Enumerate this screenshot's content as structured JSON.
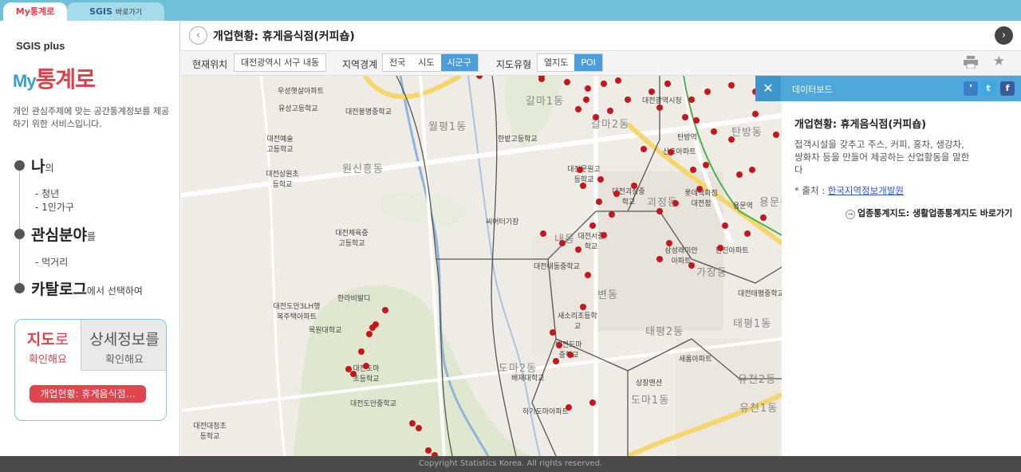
{
  "tabs": {
    "my": "My통계로",
    "sgis_brand": "SGIS",
    "sgis_small": "바로가기"
  },
  "sidebar": {
    "sgis_logo": "SGIS plus",
    "my_logo_my": "My",
    "my_logo_rest": "통계로",
    "description": "개인 관심주제에 맞는 공간통계정보를 제공하기 위한 서비스입니다.",
    "menu": [
      {
        "label": "나",
        "suffix": "의",
        "subs": [
          "- 청년",
          "- 1인가구"
        ]
      },
      {
        "label": "관심분야",
        "suffix": "를",
        "subs": [
          "- 먹거리"
        ]
      },
      {
        "label": "카탈로그",
        "suffix": "에서 선택하여",
        "subs": []
      }
    ],
    "result_tabs": {
      "map_big_a": "지도",
      "map_big_b": "로",
      "map_small": "확인해요",
      "detail_big": "상세정보를",
      "detail_small": "확인해요"
    },
    "selected_pill": "개업현황: 휴게음식점…"
  },
  "titlebar": {
    "back_icon": "chevron-left-icon",
    "title": "개업현황: 휴게음식점(커피숍)",
    "next_icon": "chevron-right-icon"
  },
  "toolbar": {
    "location_label": "현재위치",
    "location_value": "대전광역시 서구 내동",
    "region_label": "지역경계",
    "region_options": [
      "전국",
      "시도",
      "시군구"
    ],
    "region_selected": "시군구",
    "maptype_label": "지도유형",
    "maptype_options": [
      "열지도",
      "POI"
    ],
    "maptype_selected": "POI"
  },
  "map": {
    "labels": [
      "우성햇살아파트",
      "유성고등학교",
      "대전봉명중학교",
      "월평1동",
      "갈마1동",
      "한밭고등학교",
      "대전예술고등학교",
      "원신흥동",
      "대전상원초등학교",
      "대전문원고등학교",
      "갈마2동",
      "대전광역시청",
      "탄방역",
      "산호아파트",
      "탄방동",
      "대전괴정중학교",
      "괴정동",
      "롯데백화점대전점",
      "용문역",
      "용문동",
      "씨어터기장",
      "대전체육중고등학교",
      "내동",
      "대전서중학교",
      "대전내동중학교",
      "삼성래미안아파트",
      "한진아파트",
      "가장동",
      "한라비발디",
      "대전도안3LH행복주택아파트",
      "목원대학교",
      "대전도마초등학교",
      "대전도안중학교",
      "새소리초등학교",
      "대전도마중학교",
      "도마2동",
      "배재대학교",
      "변동",
      "태평2동",
      "태평1동",
      "대전태평중학교",
      "새롬아파트",
      "유천2동",
      "상창맨션",
      "도마1동",
      "유천1동",
      "대전대청초등학교",
      "하기도마아파트"
    ]
  },
  "databoard": {
    "header": "데이터보드",
    "close_icon": "close-icon",
    "title": "개업현황: 휴게음식점(커피숍)",
    "description": "접객시설을 갖추고 주스, 커피, 홍차, 생강차, 쌍화차 등을 만들어 제공하는 산업활동을 말한다",
    "source_prefix": "* 출처 : ",
    "source_link": "한국지역정보개발원",
    "link_text": "업종통계지도: 생활업종통계지도 바로가기"
  },
  "footer": {
    "copyright": "Copyright Statistics Korea. All rights reserved."
  },
  "colors": {
    "accent_blue": "#4ea8dc",
    "accent_red": "#e0404a",
    "poi_red": "#c4161c"
  }
}
